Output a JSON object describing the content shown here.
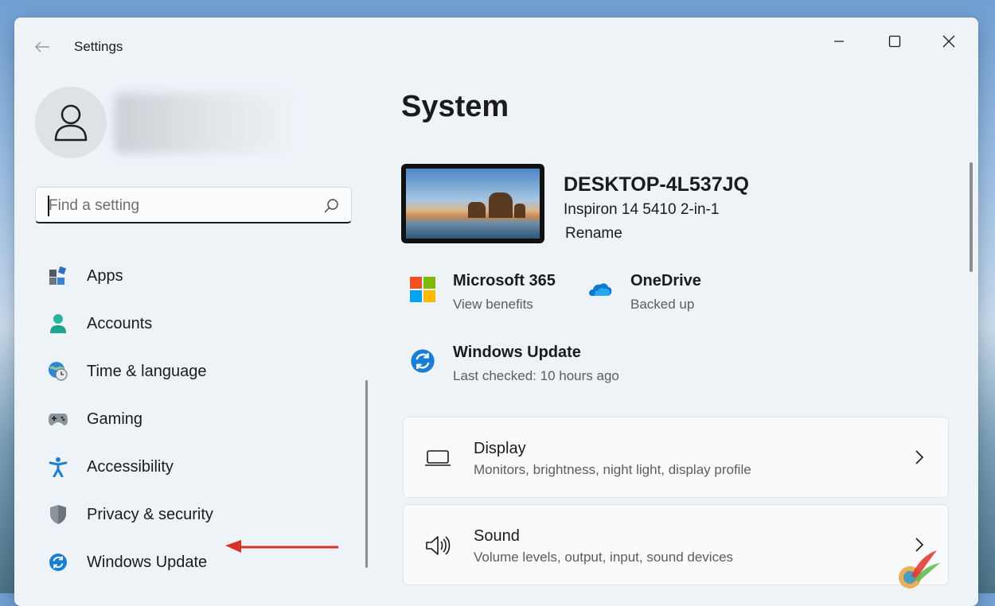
{
  "window": {
    "title": "Settings"
  },
  "search": {
    "placeholder": "Find a setting",
    "value": ""
  },
  "nav": {
    "items": [
      {
        "label": "Apps",
        "icon": "apps-icon"
      },
      {
        "label": "Accounts",
        "icon": "accounts-icon"
      },
      {
        "label": "Time & language",
        "icon": "time-language-icon"
      },
      {
        "label": "Gaming",
        "icon": "gamepad-icon"
      },
      {
        "label": "Accessibility",
        "icon": "accessibility-icon"
      },
      {
        "label": "Privacy & security",
        "icon": "shield-icon"
      },
      {
        "label": "Windows Update",
        "icon": "windows-update-icon"
      }
    ]
  },
  "main": {
    "page_title": "System",
    "device": {
      "name": "DESKTOP-4L537JQ",
      "model": "Inspiron 14 5410 2-in-1",
      "rename": "Rename"
    },
    "tiles": {
      "m365": {
        "title": "Microsoft 365",
        "subtitle": "View benefits"
      },
      "onedrive": {
        "title": "OneDrive",
        "subtitle": "Backed up"
      },
      "update": {
        "title": "Windows Update",
        "subtitle": "Last checked: 10 hours ago"
      }
    },
    "cards": [
      {
        "title": "Display",
        "subtitle": "Monitors, brightness, night light, display profile",
        "icon": "display-icon"
      },
      {
        "title": "Sound",
        "subtitle": "Volume levels, output, input, sound devices",
        "icon": "speaker-icon"
      }
    ]
  },
  "colors": {
    "accent": "#0067c0",
    "annotation_arrow": "#d9322b"
  }
}
